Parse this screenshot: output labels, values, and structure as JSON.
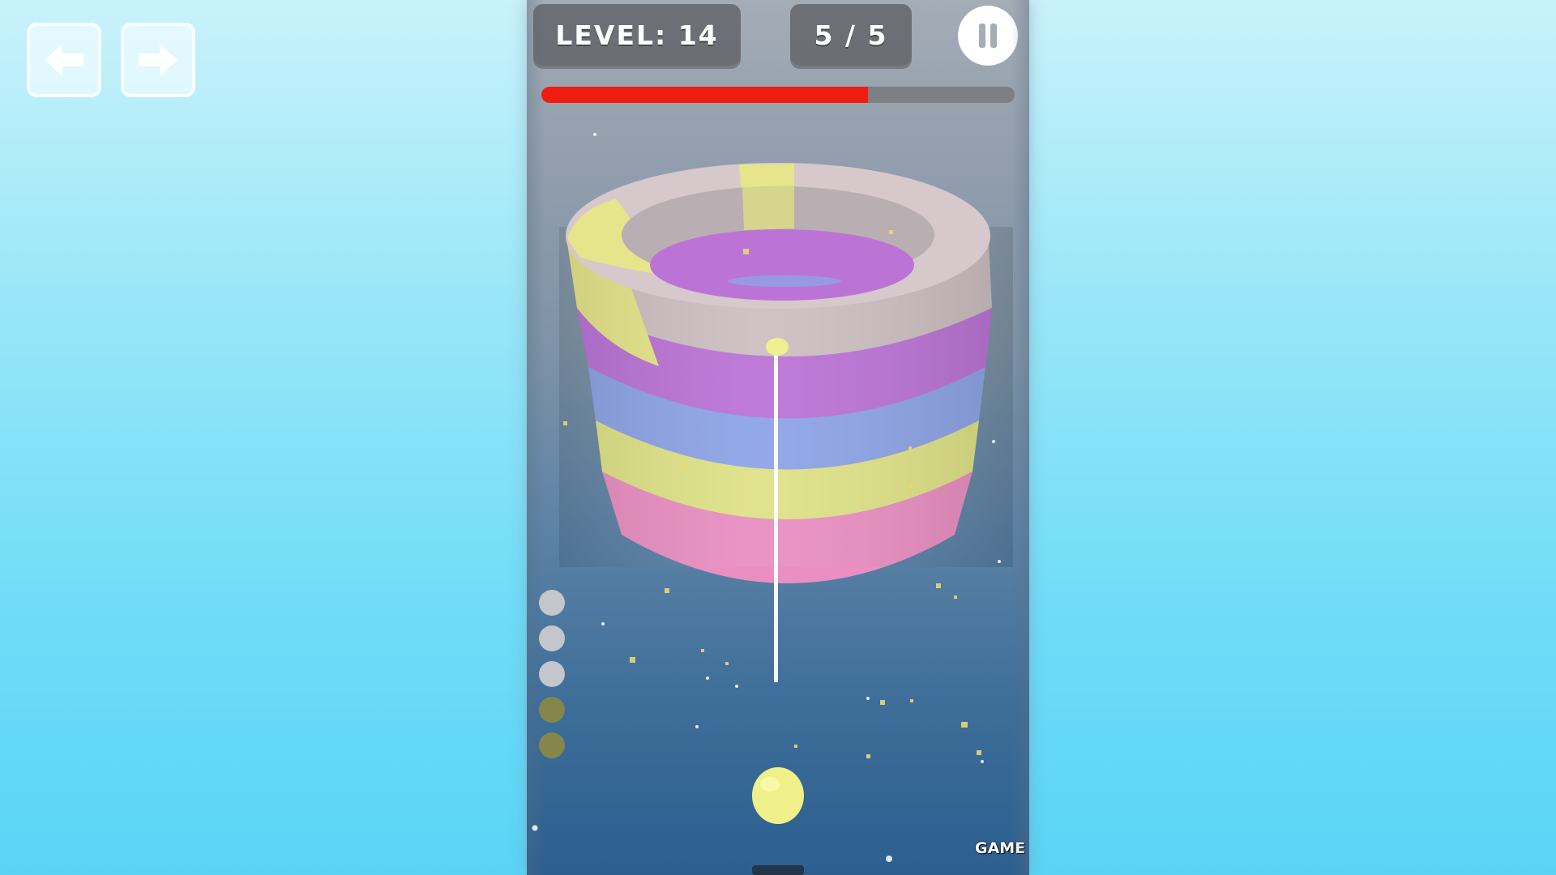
{
  "nav": {
    "prev_icon": "arrow-left-icon",
    "next_icon": "arrow-right-icon"
  },
  "hud": {
    "level_text": "LEVEL: 14",
    "moves_text": "5 / 5",
    "pause_icon": "pause-icon",
    "progress_fraction": 0.69,
    "progress_color": "#ee1d10"
  },
  "tower": {
    "top_ring_colors": [
      "#cdbfc2",
      "#e6e58b"
    ],
    "rings": [
      {
        "color": "#bb74d6"
      },
      {
        "color": "#8ea4e6"
      },
      {
        "color": "#dfe287"
      },
      {
        "color": "#e98fc2"
      }
    ]
  },
  "ammo": [
    {
      "color": "#c3c6cb"
    },
    {
      "color": "#c3c6cb"
    },
    {
      "color": "#c3c6cb"
    },
    {
      "color": "#85864a"
    },
    {
      "color": "#85864a"
    }
  ],
  "shooter_ball": {
    "color": "#f0f08a"
  },
  "logo_text": "GAME"
}
